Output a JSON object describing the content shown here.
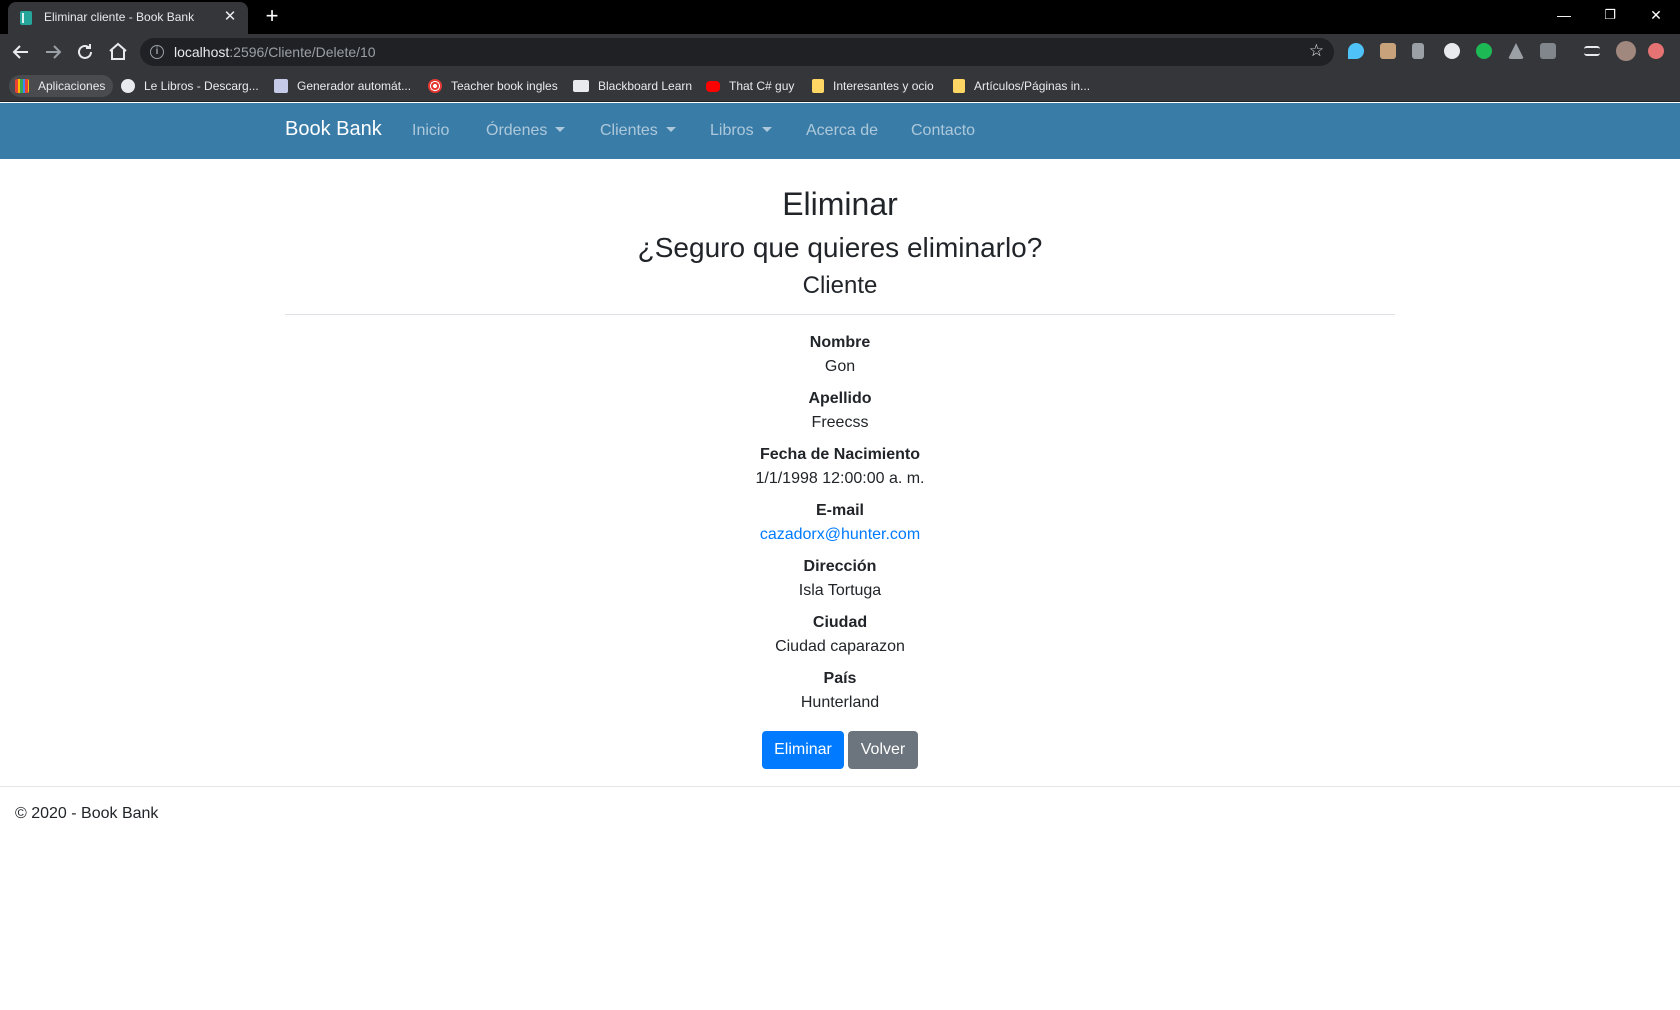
{
  "browser": {
    "tab_title": "Eliminar cliente - Book Bank",
    "tab_close": "✕",
    "new_tab": "+",
    "window_controls": {
      "minimize": "—",
      "restore": "❐",
      "close": "✕"
    },
    "url_host": "localhost",
    "url_rest": ":2596/Cliente/Delete/10",
    "star_glyph": "☆",
    "bookmarks": [
      {
        "label": "Aplicaciones",
        "icon": "apps-grid-icon"
      },
      {
        "label": "Le Libros - Descarg...",
        "icon": "globe-icon"
      },
      {
        "label": "Generador automát...",
        "icon": "document-icon"
      },
      {
        "label": "Teacher book ingles",
        "icon": "target-icon"
      },
      {
        "label": "Blackboard Learn",
        "icon": "blackboard-icon"
      },
      {
        "label": "That C# guy",
        "icon": "youtube-icon"
      },
      {
        "label": "Interesantes y ocio",
        "icon": "folder-icon"
      },
      {
        "label": "Artículos/Páginas in...",
        "icon": "folder-icon"
      }
    ]
  },
  "navbar": {
    "brand": "Book Bank",
    "links": {
      "inicio": "Inicio",
      "ordenes": "Órdenes",
      "clientes": "Clientes",
      "libros": "Libros",
      "acerca": "Acerca de",
      "contacto": "Contacto"
    },
    "color": "#3a7ca8"
  },
  "page": {
    "title": "Eliminar",
    "question": "¿Seguro que quieres eliminarlo?",
    "entity": "Cliente"
  },
  "details": {
    "nombre": {
      "label": "Nombre",
      "value": "Gon"
    },
    "apellido": {
      "label": "Apellido",
      "value": "Freecss"
    },
    "fecha": {
      "label": "Fecha de Nacimiento",
      "value": "1/1/1998 12:00:00 a. m."
    },
    "email": {
      "label": "E-mail",
      "value": "cazadorx@hunter.com"
    },
    "direccion": {
      "label": "Dirección",
      "value": "Isla Tortuga"
    },
    "ciudad": {
      "label": "Ciudad",
      "value": "Ciudad caparazon"
    },
    "pais": {
      "label": "País",
      "value": "Hunterland"
    }
  },
  "actions": {
    "delete_label": "Eliminar",
    "back_label": "Volver"
  },
  "footer": {
    "text": "© 2020 - Book Bank"
  },
  "colors": {
    "primary": "#007bff",
    "secondary": "#6c757d",
    "link": "#007bff"
  }
}
